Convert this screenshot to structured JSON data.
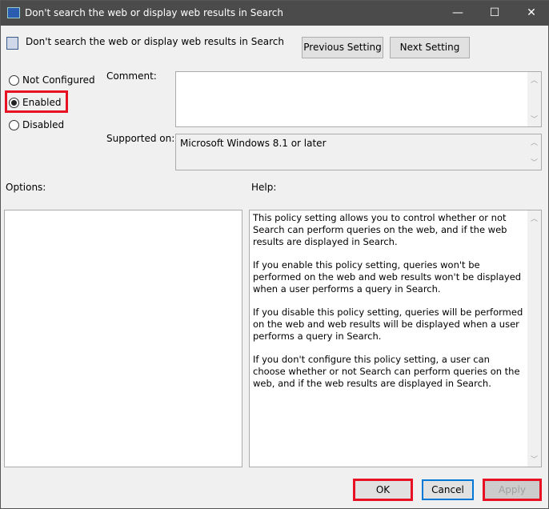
{
  "window": {
    "title": "Don't search the web or display web results in Search",
    "minimize": "—",
    "maximize": "☐",
    "close": "✕"
  },
  "header": {
    "title": "Don't search the web or display web results in Search",
    "previous_setting": "Previous Setting",
    "next_setting": "Next Setting"
  },
  "state": {
    "options": [
      "Not Configured",
      "Enabled",
      "Disabled"
    ],
    "selected": "Enabled"
  },
  "comment": {
    "label": "Comment:",
    "value": ""
  },
  "supported": {
    "label": "Supported on:",
    "value": "Microsoft Windows 8.1 or later"
  },
  "options_label": "Options:",
  "help_label": "Help:",
  "help": [
    "This policy setting allows you to control whether or not Search can perform queries on the web, and if the web results are displayed in Search.",
    "If you enable this policy setting, queries won't be performed on the web and web results won't be displayed when a user performs a query in Search.",
    "If you disable this policy setting, queries will be performed on the web and web results will be displayed when a user performs a query in Search.",
    "If you don't configure this policy setting, a user can choose whether or not Search can perform queries on the web, and if the web results are displayed in Search."
  ],
  "buttons": {
    "ok": "OK",
    "cancel": "Cancel",
    "apply": "Apply"
  },
  "colors": {
    "highlight": "#e81123",
    "focus": "#0078d7",
    "titlebar": "#4b4b4b"
  }
}
